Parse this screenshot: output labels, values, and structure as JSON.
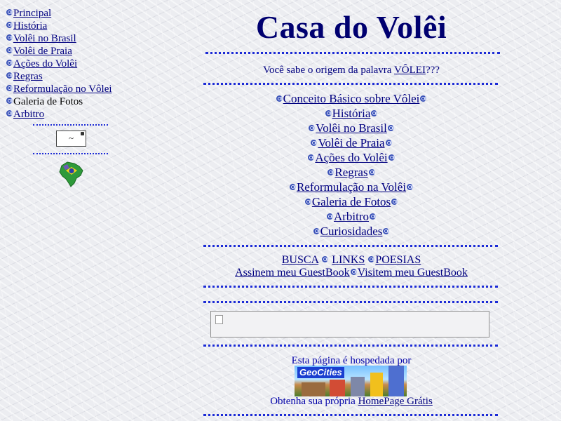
{
  "sidebar": {
    "items": [
      {
        "label": "Principal",
        "link": true
      },
      {
        "label": "História",
        "link": true
      },
      {
        "label": "Volêi no Brasil",
        "link": true
      },
      {
        "label": "Volêi de Praia",
        "link": true
      },
      {
        "label": "Ações do Volêi",
        "link": true
      },
      {
        "label": "Regras",
        "link": true
      },
      {
        "label": "Reformulação no Vôlei",
        "link": true
      },
      {
        "label": "Galeria de Fotos",
        "link": false
      },
      {
        "label": "Arbitro",
        "link": true
      }
    ]
  },
  "header": {
    "title": "Casa do Volêi"
  },
  "question": {
    "prefix": "Você sabe o origem da palavra ",
    "link": "VÔLEI",
    "suffix": "???"
  },
  "menu": {
    "items": [
      "Conceito Básico sobre Vôlei",
      "História",
      "Volêi no Brasil",
      "Volêi de Praia",
      "Ações do Volêi",
      "Regras",
      "Reformulação na Volêi",
      "Galeria de Fotos",
      "Arbitro",
      "Curiosidades"
    ]
  },
  "extras": {
    "busca": "BUSCA",
    "links": "LINKS",
    "poesias": "POESIAS",
    "assinem": "Assinem meu GuestBook",
    "visitem": "Visitem meu GuestBook"
  },
  "hosting": {
    "hosted_text": "Esta página é hospedada por",
    "banner_logo": "GeoCities",
    "get_prefix": "Obtenha sua própria ",
    "get_link": "HomePage Grátis"
  },
  "colors": {
    "link": "#000080",
    "rule": "#1c2bd6",
    "background": "#ecedf1"
  },
  "icons": [
    "swirl-bullet-icon",
    "mail-icon",
    "brazil-map-icon",
    "broken-image-icon"
  ]
}
